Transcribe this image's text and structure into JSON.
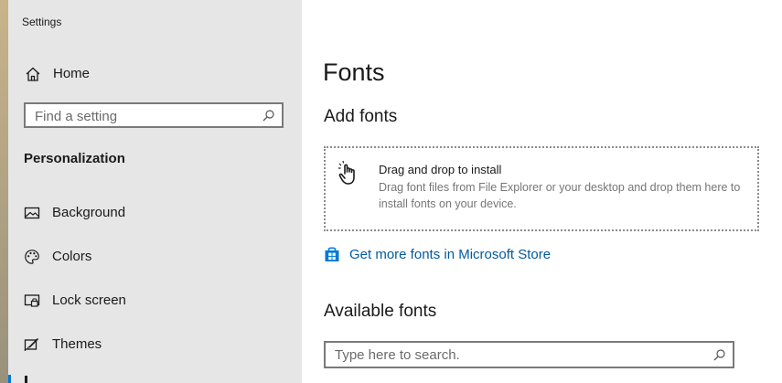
{
  "window": {
    "title": "Settings"
  },
  "sidebar": {
    "home_label": "Home",
    "search_placeholder": "Find a setting",
    "section_heading": "Personalization",
    "items": [
      {
        "label": "Background",
        "icon": "image-icon"
      },
      {
        "label": "Colors",
        "icon": "palette-icon"
      },
      {
        "label": "Lock screen",
        "icon": "lock-screen-icon"
      },
      {
        "label": "Themes",
        "icon": "themes-icon"
      }
    ]
  },
  "main": {
    "page_title": "Fonts",
    "add_fonts_heading": "Add fonts",
    "drop_zone": {
      "title": "Drag and drop to install",
      "description": "Drag font files from File Explorer or your desktop and drop them here to install fonts on your device.",
      "icon": "drag-hand-icon"
    },
    "store_link": {
      "label": "Get more fonts in Microsoft Store",
      "icon": "store-icon"
    },
    "available_fonts_heading": "Available fonts",
    "fonts_search_placeholder": "Type here to search."
  },
  "colors": {
    "sidebar_bg": "#e6e6e6",
    "link": "#005a9e",
    "accent": "#0078d7"
  }
}
